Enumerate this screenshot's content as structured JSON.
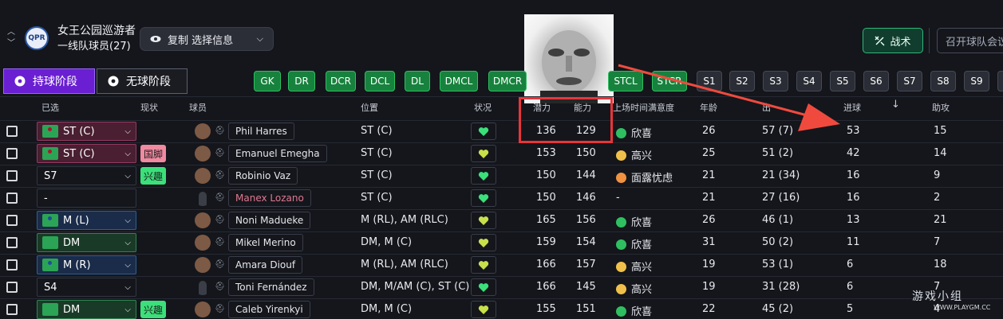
{
  "header": {
    "club_name": "女王公园巡游者",
    "squad_name": "一线队球员(27)",
    "copy_button": "复制 选择信息",
    "tactics_button": "战术",
    "meeting_button": "召开球队会议",
    "crest_text": "QPR"
  },
  "phases": {
    "in_possession": "持球阶段",
    "out_of_possession": "无球阶段"
  },
  "position_filters": [
    "GK",
    "DR",
    "DCR",
    "DCL",
    "DL",
    "DMCL",
    "DMCR",
    "",
    "STCL",
    "STCR",
    "S1",
    "S2",
    "S3",
    "S4",
    "S5",
    "S6",
    "S7",
    "S8",
    "S9"
  ],
  "columns": {
    "selected": "已选",
    "status": "现状",
    "player": "球员",
    "position": "位置",
    "condition": "状况",
    "potential": "潜力",
    "ability": "能力",
    "playing_time": "上场时间满意度",
    "age": "年龄",
    "apps": "出场",
    "goals": "进球",
    "assists": "助攻"
  },
  "rows": [
    {
      "role": "ST (C)",
      "tag": "",
      "name": "Phil Harres",
      "position": "ST (C)",
      "potential": "136",
      "ability": "129",
      "mood": "欣喜",
      "mood_color": "green",
      "age": "26",
      "apps": "57 (7)",
      "goals": "53",
      "assists": "15"
    },
    {
      "role": "ST (C)",
      "tag": "国脚",
      "name": "Emanuel Emegha",
      "position": "ST (C)",
      "potential": "153",
      "ability": "150",
      "mood": "高兴",
      "mood_color": "yellow",
      "age": "25",
      "apps": "51 (2)",
      "goals": "42",
      "assists": "14"
    },
    {
      "role": "S7",
      "tag": "兴趣",
      "name": "Robinio Vaz",
      "position": "ST (C)",
      "potential": "150",
      "ability": "144",
      "mood": "面露忧虑",
      "mood_color": "orange",
      "age": "21",
      "apps": "21 (34)",
      "goals": "16",
      "assists": "9"
    },
    {
      "role": "-",
      "tag": "",
      "name": "Manex Lozano",
      "position": "ST (C)",
      "potential": "150",
      "ability": "146",
      "mood": "-",
      "mood_color": "",
      "age": "21",
      "apps": "27 (16)",
      "goals": "16",
      "assists": "2"
    },
    {
      "role": "M (L)",
      "tag": "",
      "name": "Noni Madueke",
      "position": "M (RL), AM (RLC)",
      "potential": "165",
      "ability": "156",
      "mood": "欣喜",
      "mood_color": "green",
      "age": "26",
      "apps": "46 (1)",
      "goals": "13",
      "assists": "21"
    },
    {
      "role": "DM",
      "tag": "",
      "name": "Mikel Merino",
      "position": "DM, M (C)",
      "potential": "159",
      "ability": "154",
      "mood": "欣喜",
      "mood_color": "green",
      "age": "31",
      "apps": "50 (2)",
      "goals": "11",
      "assists": "7"
    },
    {
      "role": "M (R)",
      "tag": "",
      "name": "Amara Diouf",
      "position": "M (RL), AM (RLC)",
      "potential": "166",
      "ability": "157",
      "mood": "高兴",
      "mood_color": "yellow",
      "age": "19",
      "apps": "53 (1)",
      "goals": "6",
      "assists": "18"
    },
    {
      "role": "S4",
      "tag": "",
      "name": "Toni Fernández",
      "position": "DM, M/AM (C), ST (C)",
      "potential": "166",
      "ability": "145",
      "mood": "高兴",
      "mood_color": "yellow",
      "age": "19",
      "apps": "31 (28)",
      "goals": "6",
      "assists": "7"
    },
    {
      "role": "DM",
      "tag": "兴趣",
      "name": "Caleb Yirenkyi",
      "position": "DM, M (C)",
      "potential": "155",
      "ability": "151",
      "mood": "欣喜",
      "mood_color": "green",
      "age": "22",
      "apps": "45 (2)",
      "goals": "5",
      "assists": "4"
    }
  ],
  "watermark": {
    "text": "游戏小组",
    "url": "WWW.PLAYGM.CC"
  },
  "colors": {
    "accent_purple": "#6a1fd2",
    "position_green": "#17823d",
    "highlight_red": "#e8353a"
  }
}
